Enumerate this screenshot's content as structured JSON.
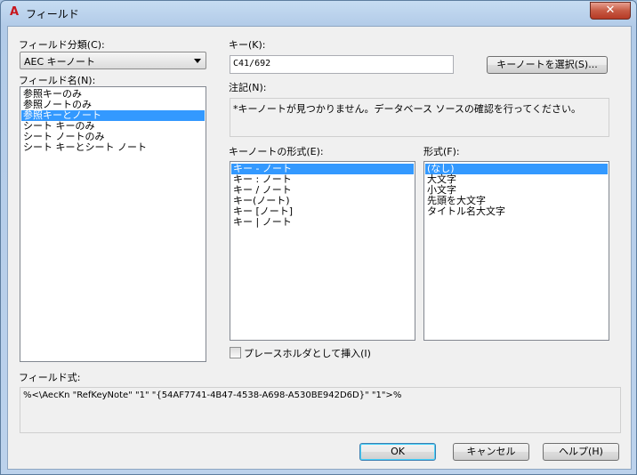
{
  "window": {
    "title": "フィールド",
    "close_glyph": "✕",
    "app_icon_glyph": "A"
  },
  "left": {
    "category_label": "フィールド分類(C):",
    "category_value": "AEC キーノート",
    "field_names_label": "フィールド名(N):",
    "field_names": [
      {
        "label": "参照キーのみ",
        "selected": false
      },
      {
        "label": "参照ノートのみ",
        "selected": false
      },
      {
        "label": "参照キーとノート",
        "selected": true
      },
      {
        "label": "シート キーのみ",
        "selected": false
      },
      {
        "label": "シート ノートのみ",
        "selected": false
      },
      {
        "label": "シート キーとシート ノート",
        "selected": false
      }
    ]
  },
  "key": {
    "label": "キー(K):",
    "value": "C41/692",
    "select_button": "キーノートを選択(S)..."
  },
  "note": {
    "label": "注記(N):",
    "text": "*キーノートが見つかりません。データベース ソースの確認を行ってください。"
  },
  "format": {
    "keynote_format_label": "キーノートの形式(E):",
    "keynote_formats": [
      {
        "label": "キー - ノート",
        "selected": true
      },
      {
        "label": "キー : ノート",
        "selected": false
      },
      {
        "label": "キー / ノート",
        "selected": false
      },
      {
        "label": "キー(ノート)",
        "selected": false
      },
      {
        "label": "キー [ノート]",
        "selected": false
      },
      {
        "label": "キー | ノート",
        "selected": false
      }
    ],
    "text_format_label": "形式(F):",
    "text_formats": [
      {
        "label": "(なし)",
        "selected": true
      },
      {
        "label": "大文字",
        "selected": false
      },
      {
        "label": "小文字",
        "selected": false
      },
      {
        "label": "先頭を大文字",
        "selected": false
      },
      {
        "label": "タイトル名大文字",
        "selected": false
      }
    ],
    "placeholder_checkbox_label": "プレースホルダとして挿入(I)",
    "placeholder_checked": false
  },
  "expression": {
    "label": "フィールド式:",
    "value": "%<\\AecKn \"RefKeyNote\" \"1\" \"{54AF7741-4B47-4538-A698-A530BE942D6D}\" \"1\">%"
  },
  "buttons": {
    "ok": "OK",
    "cancel": "キャンセル",
    "help": "ヘルプ(H)"
  }
}
